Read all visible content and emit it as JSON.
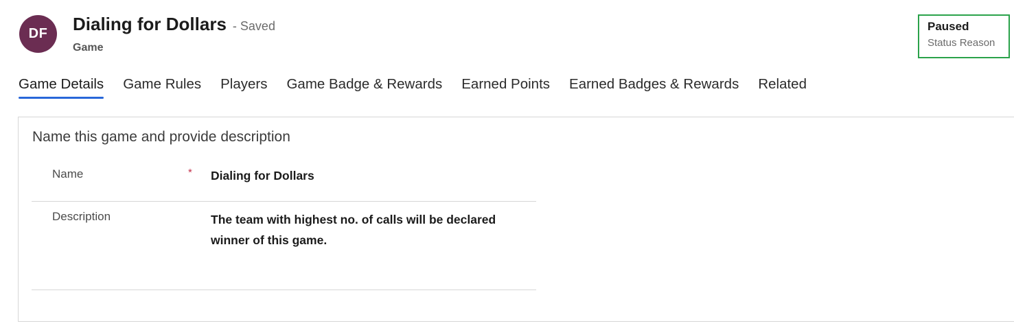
{
  "header": {
    "avatar_initials": "DF",
    "avatar_color": "#6b2d52",
    "title": "Dialing for Dollars",
    "save_status": "- Saved",
    "entity_type": "Game"
  },
  "status": {
    "value": "Paused",
    "label": "Status Reason",
    "highlight_color": "#2aa24a"
  },
  "tabs": [
    {
      "label": "Game Details",
      "active": true
    },
    {
      "label": "Game Rules",
      "active": false
    },
    {
      "label": "Players",
      "active": false
    },
    {
      "label": "Game Badge & Rewards",
      "active": false
    },
    {
      "label": "Earned Points",
      "active": false
    },
    {
      "label": "Earned Badges & Rewards",
      "active": false
    },
    {
      "label": "Related",
      "active": false
    }
  ],
  "accent_color": "#2867d9",
  "section": {
    "title": "Name this game and provide description",
    "fields": {
      "name": {
        "label": "Name",
        "required_marker": "*",
        "value": "Dialing for Dollars"
      },
      "description": {
        "label": "Description",
        "value": "The team with highest no. of calls will be declared winner of this game."
      }
    }
  }
}
